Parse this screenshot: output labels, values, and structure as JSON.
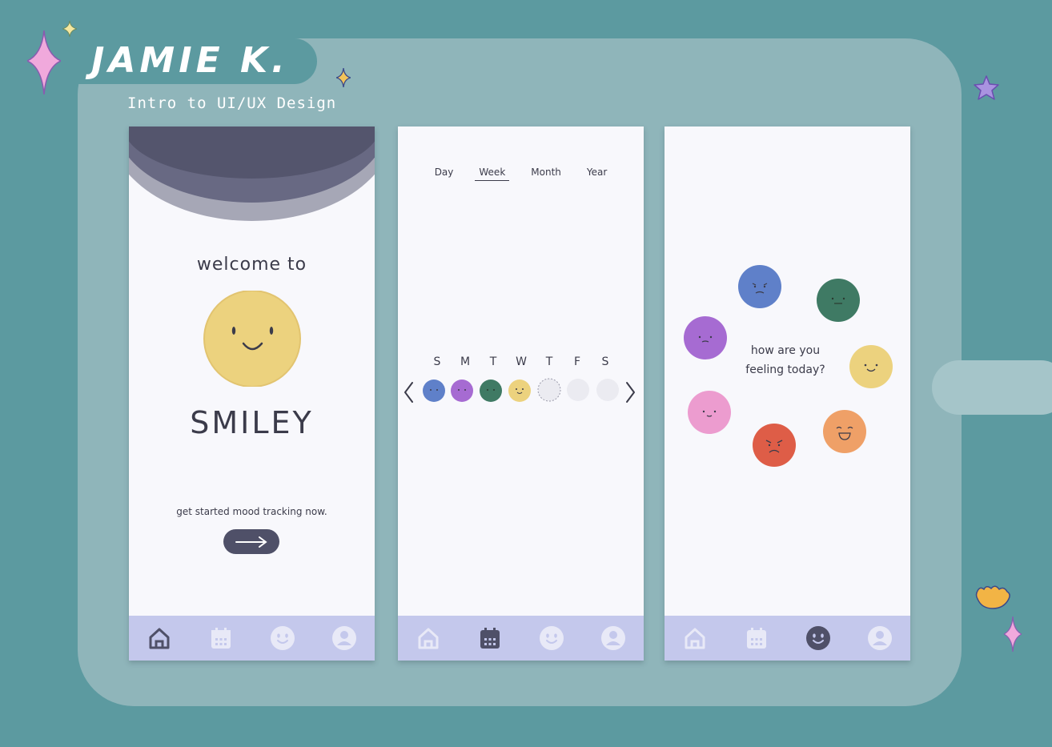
{
  "header": {
    "title": "JAMIE K.",
    "subtitle": "Intro to UI/UX Design"
  },
  "colors": {
    "background": "#5c9aa0",
    "board": "#8fb5ba",
    "nav": "#c4c8ec",
    "dark": "#4f5068",
    "yellow": "#ecd27e",
    "blue": "#5f80c9",
    "purple": "#a66bd2",
    "green": "#3f7a64",
    "pink": "#ec9ccf",
    "red": "#de5d47",
    "orange": "#efa067"
  },
  "screen1": {
    "welcome": "welcome to",
    "brand": "SMILEY",
    "cta_text": "get started mood tracking now.",
    "cta_icon": "arrow-right-icon"
  },
  "screen2": {
    "tabs": [
      {
        "label": "Day"
      },
      {
        "label": "Week"
      },
      {
        "label": "Month"
      },
      {
        "label": "Year"
      }
    ],
    "active_tab": "Week",
    "days": [
      "S",
      "M",
      "T",
      "W",
      "T",
      "F",
      "S"
    ],
    "week_moods": [
      "blue",
      "purple",
      "green",
      "yellow",
      "today-empty",
      "empty",
      "empty"
    ]
  },
  "screen3": {
    "prompt_line1": "how are you",
    "prompt_line2": "feeling today?",
    "moods": [
      "blue",
      "green",
      "purple",
      "yellow",
      "pink",
      "red",
      "orange"
    ]
  },
  "nav": {
    "items": [
      {
        "icon": "home-icon"
      },
      {
        "icon": "calendar-icon"
      },
      {
        "icon": "smiley-icon"
      },
      {
        "icon": "profile-icon"
      }
    ],
    "active_by_screen": [
      "home-icon",
      "calendar-icon",
      "smiley-icon"
    ]
  }
}
